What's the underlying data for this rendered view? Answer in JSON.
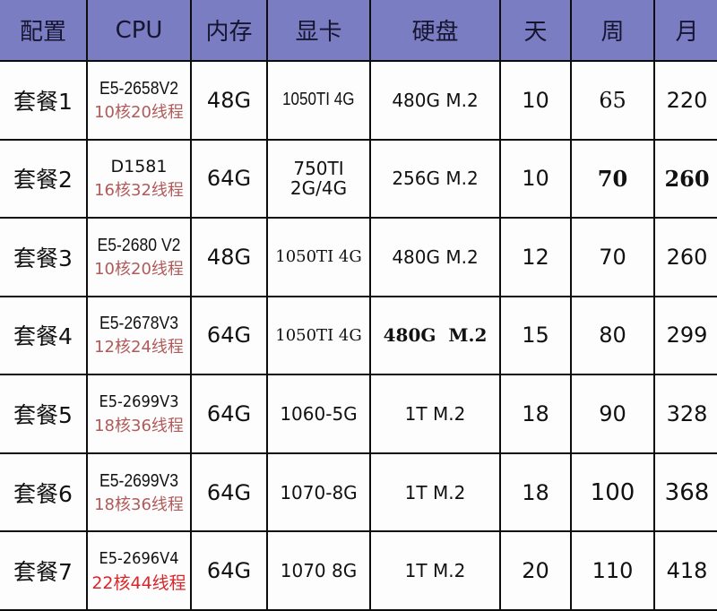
{
  "table": {
    "headers": {
      "name": "配置",
      "cpu": "CPU",
      "ram": "内存",
      "gpu": "显卡",
      "disk": "硬盘",
      "day": "天",
      "week": "周",
      "month": "月"
    },
    "colors": {
      "header_bg": "#7b7dc2",
      "cores_text": "#b05a5a",
      "cores_highlight": "#d8262a",
      "border": "#0d0d0d"
    },
    "rows": [
      {
        "name": "套餐1",
        "cpu_model": "E5-2658V2",
        "cpu_cores": "10核20线程",
        "ram": "48G",
        "gpu": "1050TI 4G",
        "gpu_line2": "",
        "disk": "480G M.2",
        "day": "10",
        "week": "65",
        "month": "220"
      },
      {
        "name": "套餐2",
        "cpu_model": "D1581",
        "cpu_cores": "16核32线程",
        "ram": "64G",
        "gpu": "750TI",
        "gpu_line2": "2G/4G",
        "disk": "256G M.2",
        "day": "10",
        "week": "70",
        "month": "260"
      },
      {
        "name": "套餐3",
        "cpu_model": "E5-2680 V2",
        "cpu_cores": "10核20线程",
        "ram": "48G",
        "gpu": "1050TI 4G",
        "gpu_line2": "",
        "disk": "480G M.2",
        "day": "12",
        "week": "70",
        "month": "260"
      },
      {
        "name": "套餐4",
        "cpu_model": "E5-2678V3",
        "cpu_cores": "12核24线程",
        "ram": "64G",
        "gpu": "1050TI 4G",
        "gpu_line2": "",
        "disk": "480G  M.2",
        "day": "15",
        "week": "80",
        "month": "299"
      },
      {
        "name": "套餐5",
        "cpu_model": "E5-2699V3",
        "cpu_cores": "18核36线程",
        "ram": "64G",
        "gpu": "1060-5G",
        "gpu_line2": "",
        "disk": "1T M.2",
        "day": "18",
        "week": "90",
        "month": "328"
      },
      {
        "name": "套餐6",
        "cpu_model": "E5-2699V3",
        "cpu_cores": "18核36线程",
        "ram": "64G",
        "gpu": "1070-8G",
        "gpu_line2": "",
        "disk": "1T M.2",
        "day": "18",
        "week": "100",
        "month": "368"
      },
      {
        "name": "套餐7",
        "cpu_model": "E5-2696V4",
        "cpu_cores": "22核44线程",
        "ram": "64G",
        "gpu": "1070 8G",
        "gpu_line2": "",
        "disk": "1T M.2",
        "day": "20",
        "week": "110",
        "month": "418"
      }
    ]
  }
}
